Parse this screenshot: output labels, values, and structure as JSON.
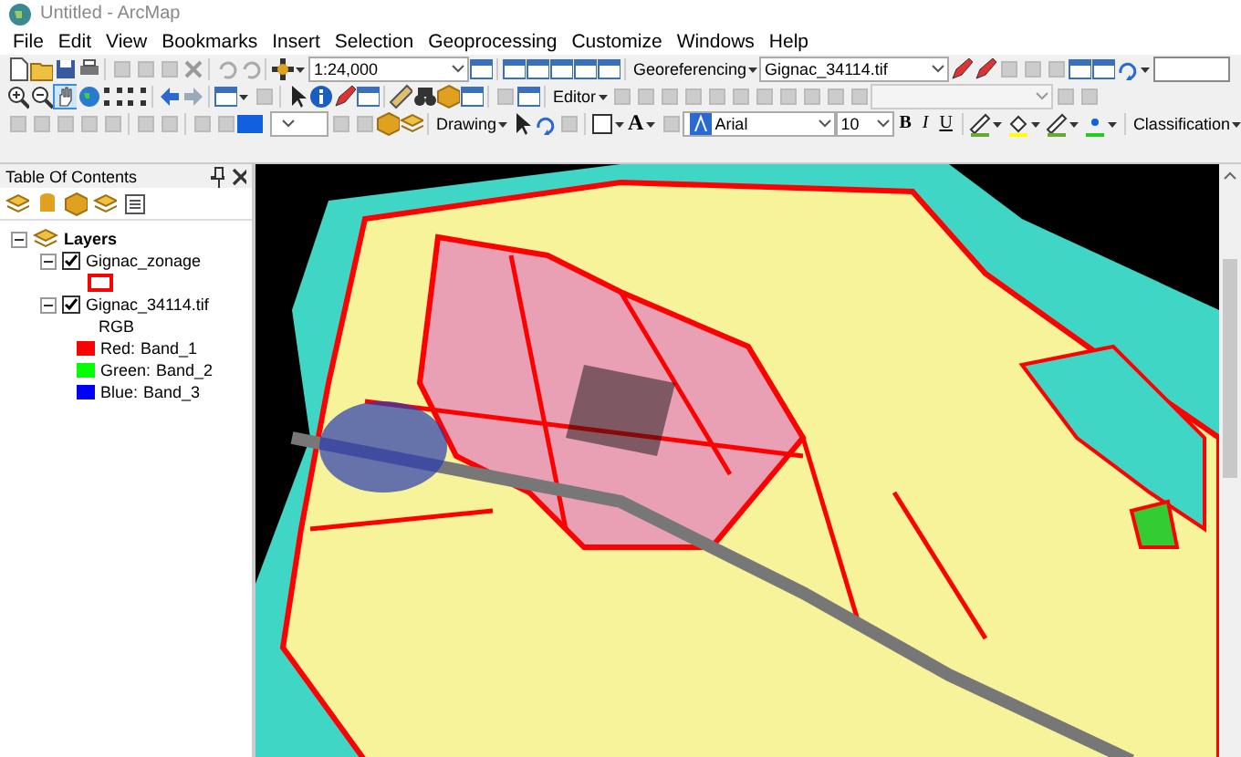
{
  "window": {
    "title": "Untitled - ArcMap"
  },
  "menu": [
    "File",
    "Edit",
    "View",
    "Bookmarks",
    "Insert",
    "Selection",
    "Geoprocessing",
    "Customize",
    "Windows",
    "Help"
  ],
  "toolbars": {
    "scale": "1:24,000",
    "georeferencing": {
      "label": "Georeferencing",
      "layer": "Gignac_34114.tif"
    },
    "editor": "Editor",
    "drawing": "Drawing",
    "text_tool": "A",
    "font": "Arial",
    "font_size": "10",
    "format_buttons": [
      "B",
      "I",
      "U"
    ],
    "classification": "Classification"
  },
  "toc": {
    "title": "Table Of Contents",
    "root": {
      "name": "Layers",
      "expanded": true,
      "children": [
        {
          "kind": "vector",
          "name": "Gignac_zonage",
          "checked": true,
          "expanded": true,
          "color": "#ff0000"
        },
        {
          "kind": "raster",
          "name": "Gignac_34114.tif",
          "checked": true,
          "expanded": true,
          "renderer": "RGB",
          "bands": [
            {
              "channel": "Red:",
              "band": "Band_1",
              "color": "#ff0000"
            },
            {
              "channel": "Green:",
              "band": "Band_2",
              "color": "#00ff00"
            },
            {
              "channel": "Blue:",
              "band": "Band_3",
              "color": "#0000ff"
            }
          ]
        }
      ]
    }
  }
}
